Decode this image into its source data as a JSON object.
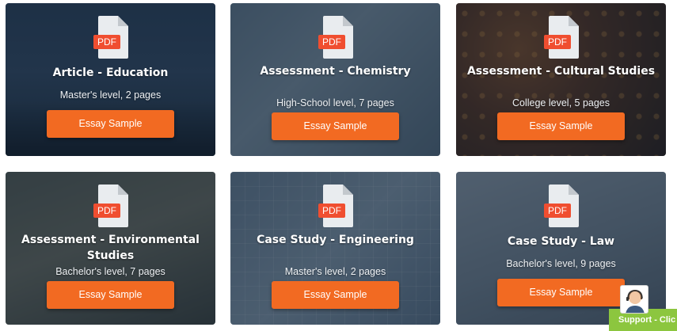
{
  "cards": [
    {
      "title": "Article - Education",
      "meta": "Master's level, 2 pages",
      "button": "Essay Sample",
      "badge": "PDF"
    },
    {
      "title": "Assessment - Chemistry",
      "meta": "High-School level, 7 pages",
      "button": "Essay Sample",
      "badge": "PDF"
    },
    {
      "title": "Assessment - Cultural Studies",
      "meta": "College level, 5 pages",
      "button": "Essay Sample",
      "badge": "PDF"
    },
    {
      "title": "Assessment - Environmental Studies",
      "meta": "Bachelor's level, 7 pages",
      "button": "Essay Sample",
      "badge": "PDF"
    },
    {
      "title": "Case Study - Engineering",
      "meta": "Master's level, 2 pages",
      "button": "Essay Sample",
      "badge": "PDF"
    },
    {
      "title": "Case Study - Law",
      "meta": "Bachelor's level, 9 pages",
      "button": "Essay Sample",
      "badge": "PDF"
    }
  ],
  "support": {
    "label": "Support - Clic"
  },
  "colors": {
    "accent": "#f26a22",
    "support_bar": "#8cc63f",
    "pdf_badge": "#f04e30"
  },
  "icons": {
    "file": "pdf-file-icon",
    "support": "support-agent-icon"
  }
}
